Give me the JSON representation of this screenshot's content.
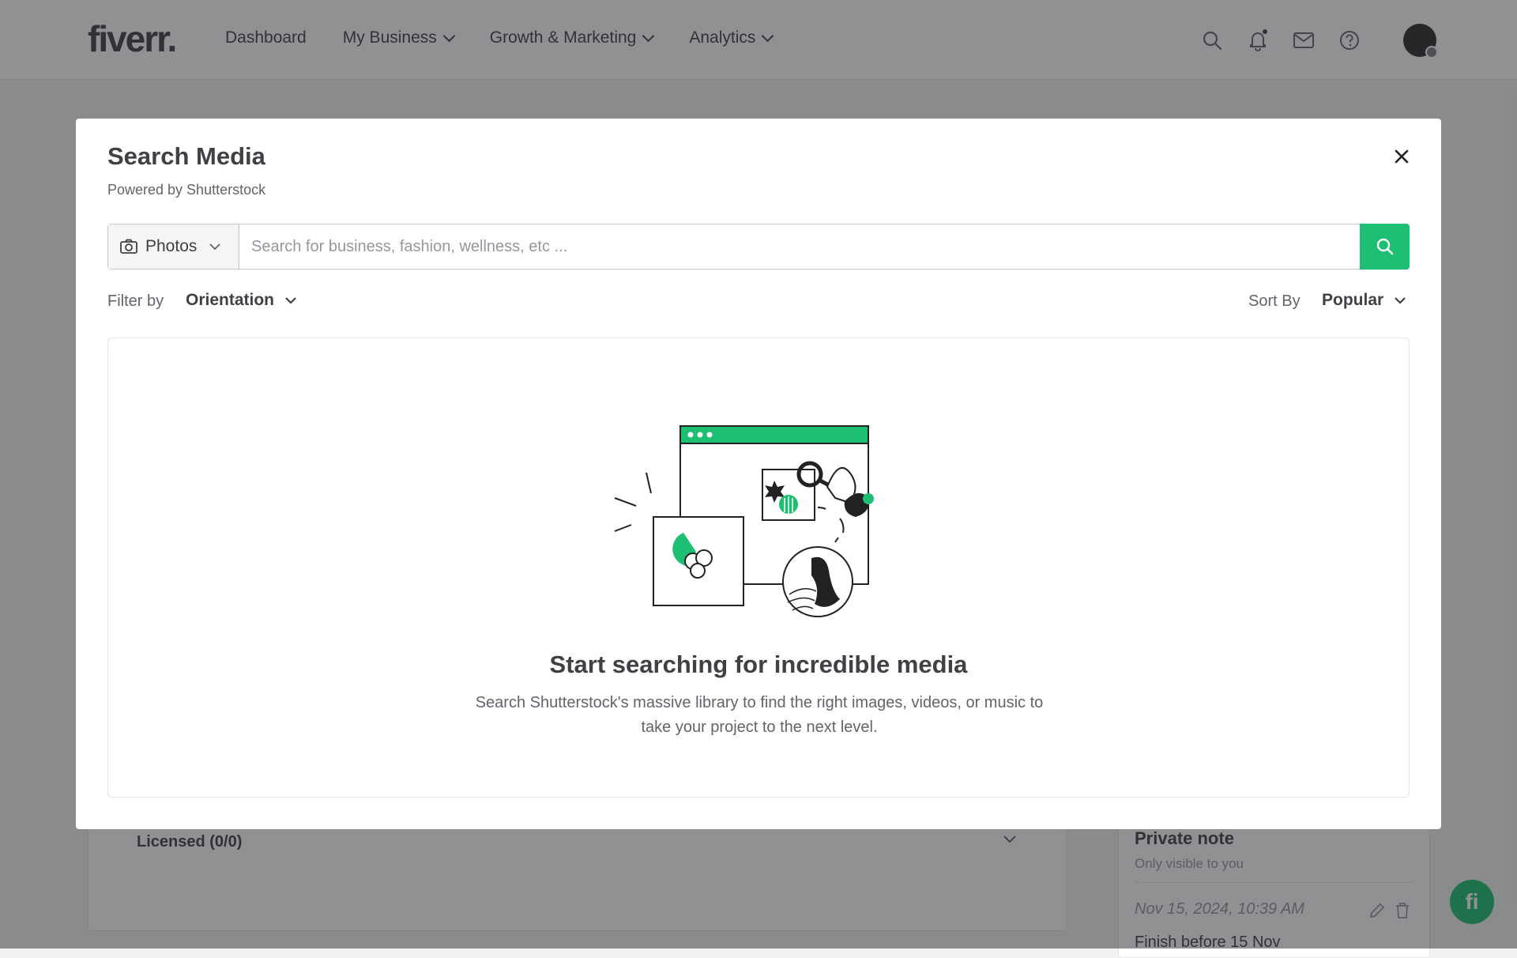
{
  "nav": {
    "logo": "fiverr",
    "logo_dot": ".",
    "links": [
      {
        "label": "Dashboard",
        "has_menu": false
      },
      {
        "label": "My Business",
        "has_menu": true
      },
      {
        "label": "Growth & Marketing",
        "has_menu": true
      },
      {
        "label": "Analytics",
        "has_menu": true
      }
    ],
    "icons": [
      "search-icon",
      "bell-icon",
      "mail-icon",
      "help-icon"
    ]
  },
  "background": {
    "licensed_label": "Licensed (0/0)",
    "private_note": {
      "title": "Private note",
      "subtitle": "Only visible to you",
      "date": "Nov 15, 2024, 10:39 AM",
      "text": "Finish before 15 Nov"
    },
    "fab_label": "fi"
  },
  "modal": {
    "title": "Search Media",
    "subtitle": "Powered by Shutterstock",
    "media_type": "Photos",
    "search_placeholder": "Search for business, fashion, wellness, etc ...",
    "search_value": "",
    "filter_label": "Filter by",
    "filter_value": "Orientation",
    "sort_label": "Sort By",
    "sort_value": "Popular",
    "empty_title": "Start searching for incredible media",
    "empty_description_line1": "Search Shutterstock's massive library to find the right images, videos, or music to",
    "empty_description_line2": "take your project to the next level."
  },
  "colors": {
    "accent": "#1dbf73",
    "text": "#404145",
    "muted": "#62646a",
    "overlay": "#222326"
  }
}
